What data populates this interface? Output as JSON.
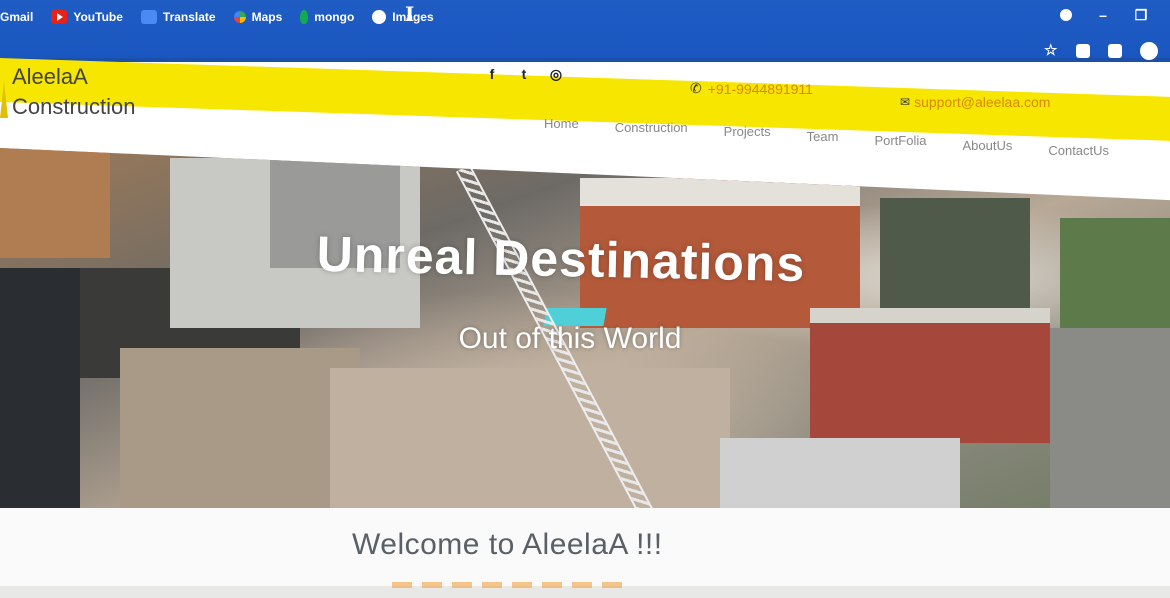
{
  "browser": {
    "bookmarks": [
      {
        "label": "Gmail",
        "icon": "gmail-icon"
      },
      {
        "label": "YouTube",
        "icon": "youtube-icon"
      },
      {
        "label": "Translate",
        "icon": "translate-icon"
      },
      {
        "label": "Maps",
        "icon": "maps-icon"
      },
      {
        "label": "mongo",
        "icon": "mongodb-icon"
      },
      {
        "label": "Images",
        "icon": "images-icon"
      }
    ]
  },
  "site": {
    "logo_line1": "AleelaA",
    "logo_line2": "Construction",
    "phone": "+91-9944891911",
    "email": "support@aleelaa.com",
    "social_icons": [
      "facebook-icon",
      "twitter-icon",
      "instagram-icon"
    ],
    "nav": [
      "Home",
      "Construction",
      "Projects",
      "Team",
      "PortFolia",
      "AboutUs",
      "ContactUs"
    ],
    "hero_title": "Unreal Destinations",
    "hero_subtitle": "Out of this World",
    "welcome": "Welcome to AleelaA !!!"
  },
  "colors": {
    "browser_bar": "#1b56c0",
    "top_strip": "#f7e600",
    "contact_text": "#d88a00",
    "welcome_text": "#5a6066"
  }
}
